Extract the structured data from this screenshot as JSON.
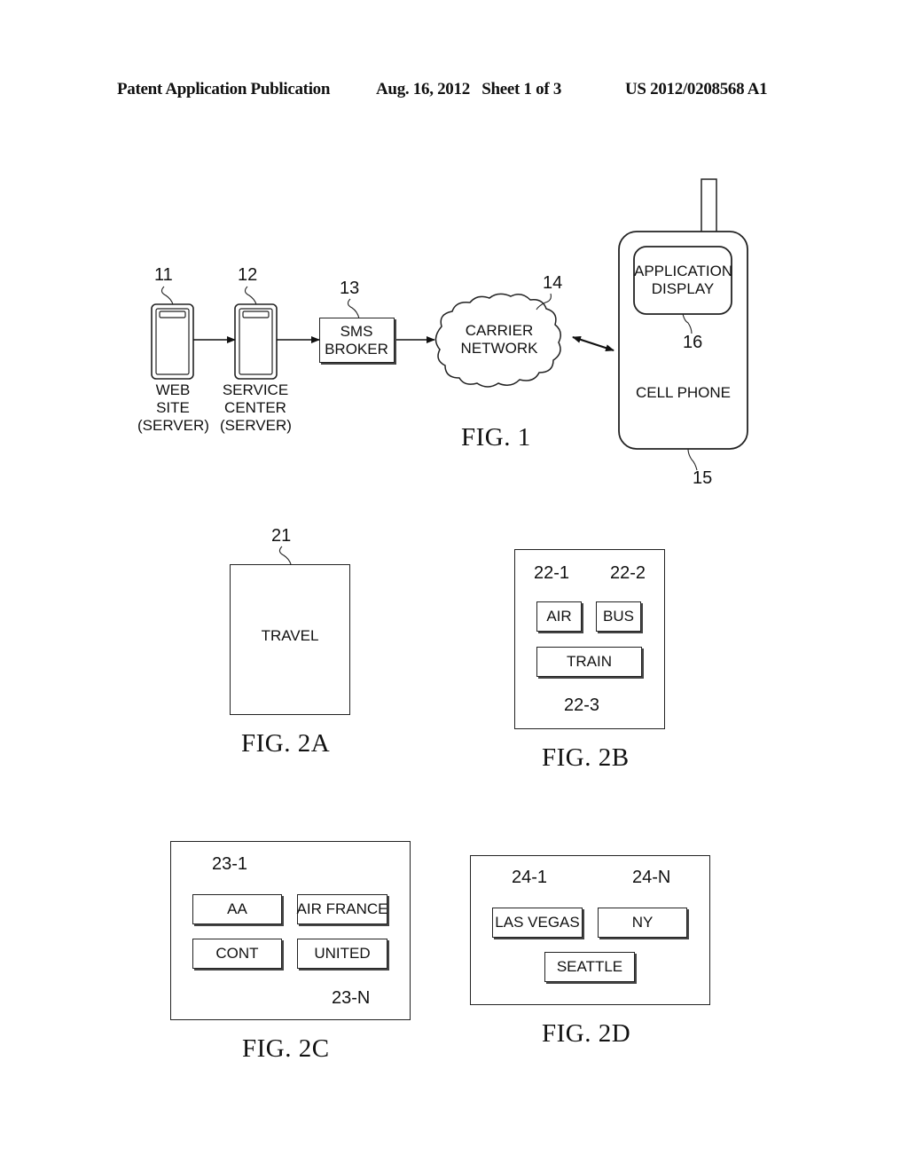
{
  "header": {
    "publication": "Patent Application Publication",
    "date_sheet": "Aug. 16, 2012   Sheet 1 of 3",
    "patent_number": "US 2012/0208568 A1"
  },
  "fig1": {
    "caption": "FIG. 1",
    "web_site": {
      "ref": "11",
      "label_lines": [
        "WEB",
        "SITE",
        "(SERVER)"
      ]
    },
    "service_center": {
      "ref": "12",
      "label_lines": [
        "SERVICE",
        "CENTER",
        "(SERVER)"
      ]
    },
    "sms_broker": {
      "ref": "13",
      "label_lines": [
        "SMS",
        "BROKER"
      ]
    },
    "carrier_network": {
      "ref": "14",
      "label_lines": [
        "CARRIER",
        "NETWORK"
      ]
    },
    "cell_phone": {
      "ref": "15",
      "label": "CELL PHONE"
    },
    "application_display": {
      "ref": "16",
      "label_lines": [
        "APPLICATION",
        "DISPLAY"
      ]
    }
  },
  "fig2a": {
    "caption": "FIG. 2A",
    "ref": "21",
    "label": "TRAVEL"
  },
  "fig2b": {
    "caption": "FIG. 2B",
    "buttons": [
      {
        "ref": "22-1",
        "label": "AIR"
      },
      {
        "ref": "22-2",
        "label": "BUS"
      },
      {
        "ref": "22-3",
        "label": "TRAIN"
      }
    ]
  },
  "fig2c": {
    "caption": "FIG. 2C",
    "refs": [
      "23-1",
      "23-N"
    ],
    "buttons": [
      {
        "label": "AA"
      },
      {
        "label": "AIR FRANCE"
      },
      {
        "label": "CONT"
      },
      {
        "label": "UNITED"
      }
    ]
  },
  "fig2d": {
    "caption": "FIG. 2D",
    "refs": [
      "24-1",
      "24-N"
    ],
    "buttons": [
      {
        "label": "LAS VEGAS"
      },
      {
        "label": "NY"
      },
      {
        "label": "SEATTLE"
      }
    ]
  }
}
